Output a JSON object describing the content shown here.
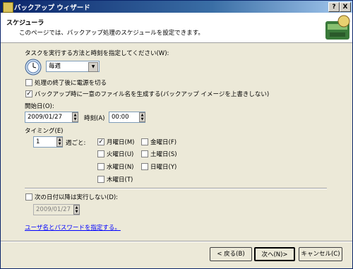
{
  "window": {
    "title": "バックアップ ウィザード",
    "help": "?",
    "close": "X"
  },
  "header": {
    "title": "スケジューラ",
    "subtitle": "このページでは、バックアップ処理のスケジュールを設定できます。"
  },
  "schedule": {
    "method_label": "タスクを実行する方法と時刻を指定してください(W):",
    "frequency_value": "毎週",
    "shutdown_label": "処理の終了後に電源を切る",
    "unique_name_label": "バックアップ時に一意のファイル名を生成する(バックアップ イメージを上書きしない)",
    "start_date_label": "開始日(O):",
    "start_date_value": "2009/01/27",
    "time_label": "時刻(A)",
    "time_value": "00:00",
    "timing_label": "タイミング(E)",
    "interval_value": "1",
    "weekly_label": "週ごと:",
    "days": {
      "mon": "月曜日(M)",
      "tue": "火曜日(U)",
      "wed": "水曜日(N)",
      "thu": "木曜日(T)",
      "fri": "金曜日(F)",
      "sat": "土曜日(S)",
      "sun": "日曜日(Y)"
    },
    "end_label": "次の日付以降は実行しない(D):",
    "end_date_value": "2009/01/27",
    "credentials_link": "ユーザ名とパスワードを指定する。"
  },
  "buttons": {
    "back": "< 戻る(B)",
    "next": "次へ(N)>",
    "cancel": "キャンセル(C)"
  }
}
